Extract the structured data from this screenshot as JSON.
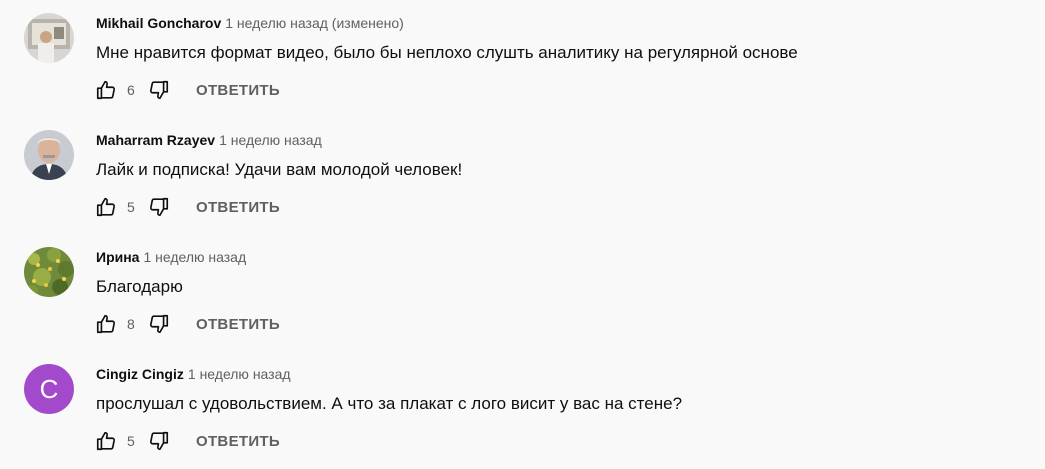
{
  "comments": [
    {
      "author": "Mikhail Goncharov",
      "time": "1 неделю назад (изменено)",
      "text": "Мне нравится формат видео, было бы неплохо слушть аналитику на регулярной основе",
      "likes": "6",
      "reply_label": "ОТВЕТИТЬ",
      "avatar": "photo-avatar"
    },
    {
      "author": "Maharram Rzayev",
      "time": "1 неделю назад",
      "text": "Лайк и подписка! Удачи вам молодой человек!",
      "likes": "5",
      "reply_label": "ОТВЕТИТЬ",
      "avatar": "photo-avatar"
    },
    {
      "author": "Ирина",
      "time": "1 неделю назад",
      "text": "Благодарю",
      "likes": "8",
      "reply_label": "ОТВЕТИТЬ",
      "avatar": "flowers-avatar"
    },
    {
      "author": "Cingiz Cingiz",
      "time": "1 неделю назад",
      "text": "прослушал с удовольствием. А что за плакат с лого висит у вас на стене?",
      "likes": "5",
      "reply_label": "ОТВЕТИТЬ",
      "avatar_letter": "C",
      "avatar_color": "#a24acb"
    }
  ],
  "icons": {
    "like": "thumb-up-icon",
    "dislike": "thumb-down-icon"
  }
}
